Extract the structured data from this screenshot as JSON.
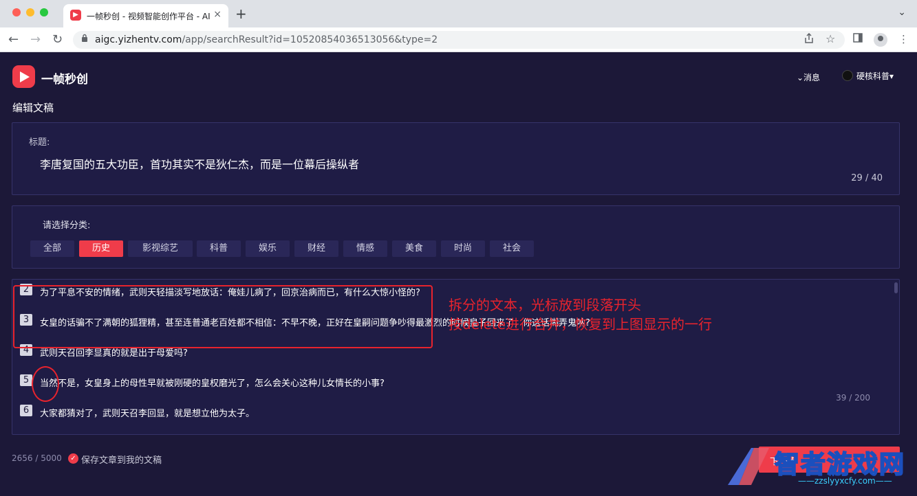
{
  "browser": {
    "tab_title": "一帧秒创 - 视频智能创作平台 - AI",
    "tab_close": "×",
    "new_tab": "+",
    "url_domain": "aigc.yizhentv.com",
    "url_path": "/app/searchResult?id=10520854036513056&type=2",
    "back": "←",
    "forward": "→",
    "reload": "↻",
    "menu": "⋮",
    "tabs_down": "⌄"
  },
  "app": {
    "logo_text": "一帧秒创",
    "messages": "⌄消息",
    "user_name": "硬核科普▾",
    "page_title": "编辑文稿"
  },
  "title_section": {
    "label": "标题:",
    "text": "李唐复国的五大功臣，首功其实不是狄仁杰，而是一位幕后操纵者",
    "count": "29 / 40"
  },
  "category_section": {
    "label": "请选择分类:",
    "items": [
      "全部",
      "历史",
      "影视综艺",
      "科普",
      "娱乐",
      "财经",
      "情感",
      "美食",
      "时尚",
      "社会"
    ],
    "active": "历史"
  },
  "paragraphs": [
    {
      "num": "2",
      "text": "为了平息不安的情绪，武则天轻描淡写地放话：俺娃儿病了，回京治病而已，有什么大惊小怪的?"
    },
    {
      "num": "3",
      "text": "女皇的话骗不了满朝的狐狸精，甚至连普通老百姓都不相信：不早不晚，正好在皇嗣问题争吵得最激烈的时候皇子回来了，你这话糊弄鬼呐?"
    },
    {
      "num": "4",
      "text": "武则天召回李显真的就是出于母爱吗?"
    },
    {
      "num": "5",
      "text": "当然不是，女皇身上的母性早就被刚硬的皇权磨光了，怎么会关心这种儿女情长的小事?"
    },
    {
      "num": "6",
      "text": "大家都猜对了，武则天召李回显，就是想立他为太子。"
    }
  ],
  "paragraph_count": "39 / 200",
  "annotation": {
    "line1": "拆分的文本，光标放到段落开头",
    "line2": "按delete进行合并，恢复到上图显示的一行"
  },
  "footer": {
    "total_count": "2656 / 5000",
    "save_label": "保存文章到我的文稿",
    "next_label": "下一步"
  },
  "watermark": {
    "text": "智者游戏网",
    "url": "——zzslyyxcfy.com——"
  },
  "colors": {
    "brand": "#ef3c4a",
    "background": "#1c1838",
    "panel": "#1f1c45",
    "annotation": "#e8232d"
  },
  "icons": {
    "lock": "lock-icon",
    "share": "share-icon",
    "star": "star-icon",
    "sidebar": "sidebar-icon",
    "profile": "profile-icon",
    "check": "check-icon"
  }
}
